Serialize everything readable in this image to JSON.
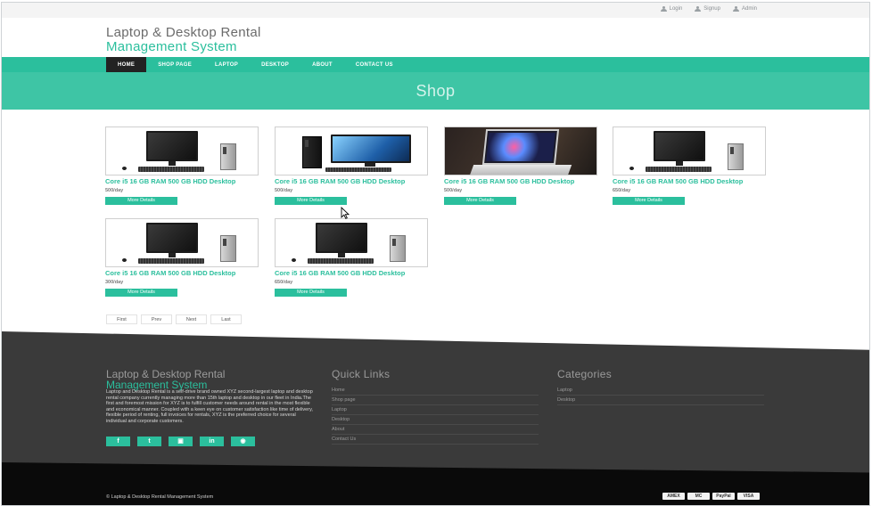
{
  "topbar": {
    "links": [
      {
        "label": "Login",
        "icon": "user-icon"
      },
      {
        "label": "Signup",
        "icon": "user-icon"
      },
      {
        "label": "Admin",
        "icon": "user-icon"
      }
    ]
  },
  "brand": {
    "line1": "Laptop & Desktop Rental",
    "line2": "Management System",
    "accent_color": "#2bbf9d"
  },
  "nav": {
    "items": [
      "HOME",
      "SHOP PAGE",
      "LAPTOP",
      "DESKTOP",
      "ABOUT",
      "CONTACT US"
    ],
    "active": "HOME"
  },
  "banner": {
    "title": "Shop"
  },
  "products": [
    {
      "title": "Core i5 16 GB RAM 500 GB HDD Desktop",
      "price": "500/day",
      "button": "More Details",
      "image": "desktop-computer"
    },
    {
      "title": "Core i5 16 GB RAM 500 GB HDD Desktop",
      "price": "500/day",
      "button": "More Details",
      "image": "desktop-computer-blue-screen"
    },
    {
      "title": "Core i5 16 GB RAM 500 GB HDD Desktop",
      "price": "500/day",
      "button": "More Details",
      "image": "laptop"
    },
    {
      "title": "Core i5 16 GB RAM 500 GB HDD Desktop",
      "price": "650/day",
      "button": "More Details",
      "image": "desktop-computer"
    },
    {
      "title": "Core i5 16 GB RAM 500 GB HDD Desktop",
      "price": "300/day",
      "button": "More Details",
      "image": "desktop-computer"
    },
    {
      "title": "Core i5 16 GB RAM 500 GB HDD Desktop",
      "price": "650/day",
      "button": "More Details",
      "image": "desktop-computer"
    }
  ],
  "pager": [
    "First",
    "Prev",
    "Next",
    "Last"
  ],
  "footer": {
    "title_line1": "Laptop & Desktop Rental",
    "title_line2": "Management System",
    "description": "Laptop and Desktop Rental is a self-drive brand owned XYZ second-largest laptop and desktop rental company currently managing more than 15th laptop and desktop in our fleet in India.The first and foremost mission for XYZ is to fulfill customer needs around rental in the most flexible and economical manner. Coupled with a keen eye on customer satisfaction like time of delivery, flexible period of renting, full invoices for rentals, XYZ is the preferred choice for several individual and corporate customers.",
    "social": [
      {
        "label": "f",
        "icon": "facebook-icon"
      },
      {
        "label": "t",
        "icon": "twitter-icon"
      },
      {
        "label": "▣",
        "icon": "youtube-icon"
      },
      {
        "label": "in",
        "icon": "linkedin-icon"
      },
      {
        "label": "◉",
        "icon": "instagram-icon"
      }
    ],
    "quick_links": {
      "heading": "Quick Links",
      "items": [
        "Home",
        "Shop page",
        "Laptop",
        "Desktop",
        "About",
        "Contact Us"
      ]
    },
    "categories": {
      "heading": "Categories",
      "items": [
        "Laptop",
        "Desktop"
      ]
    },
    "copyright": "© Laptop & Desktop Rental Management System",
    "payment_cards": [
      "AMEX",
      "MC",
      "PayPal",
      "VISA"
    ]
  }
}
